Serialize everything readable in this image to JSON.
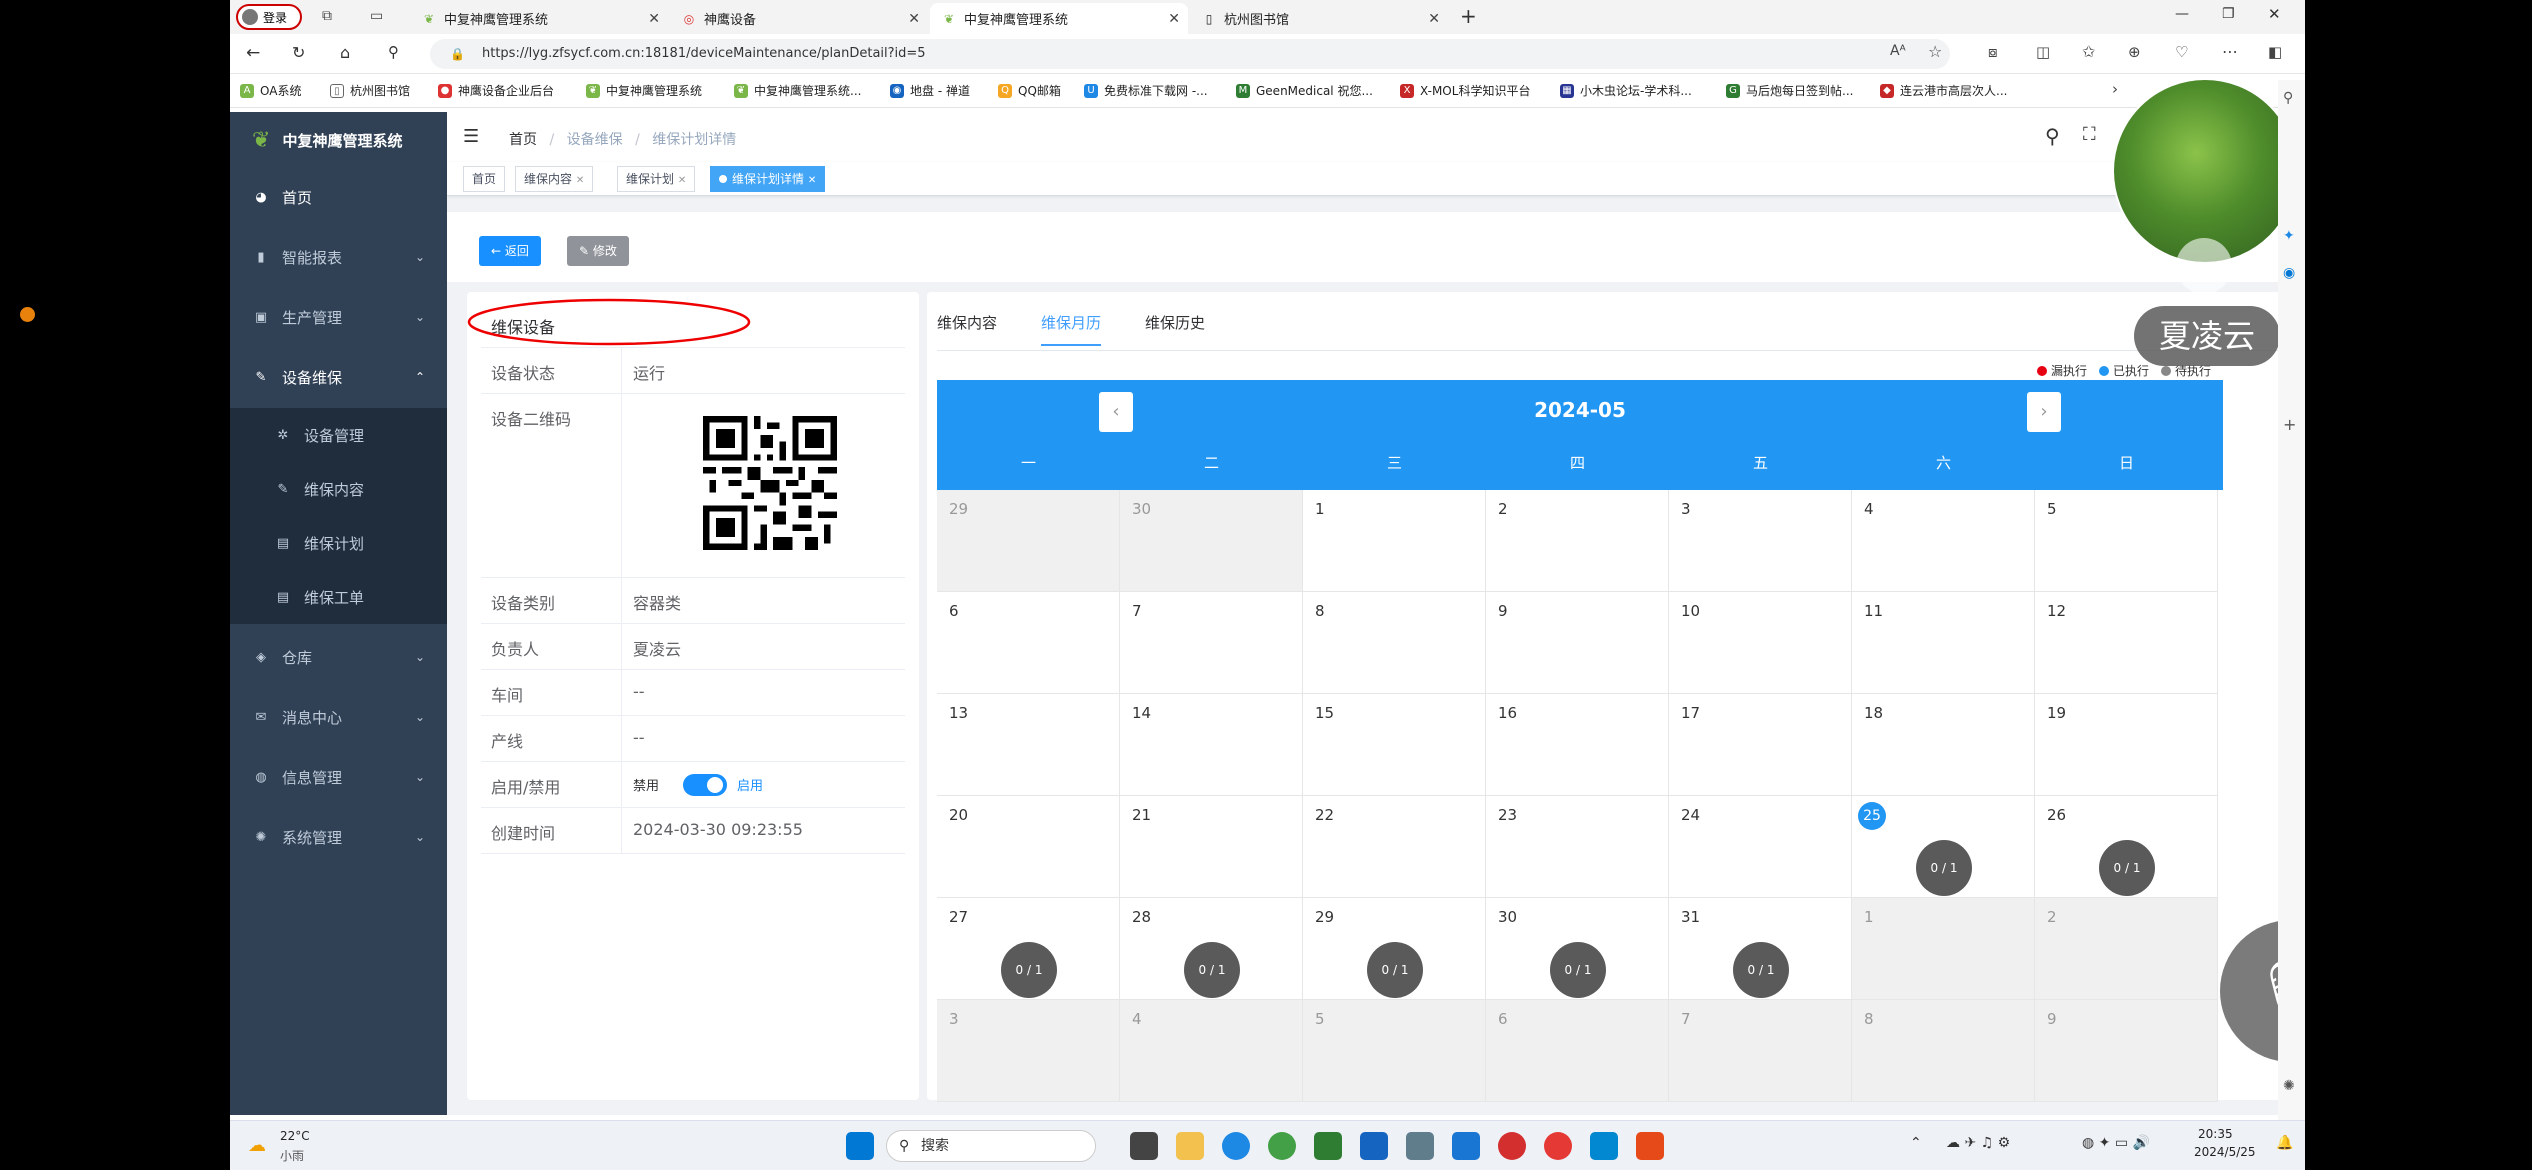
{
  "browser": {
    "login": "登录",
    "tabs": [
      {
        "label": "中复神鹰管理系统"
      },
      {
        "label": "神鹰设备"
      },
      {
        "label": "中复神鹰管理系统"
      },
      {
        "label": "杭州图书馆"
      }
    ],
    "url": "https://lyg.zfsycf.com.cn:18181/deviceMaintenance/planDetail?id=5",
    "bookmarks": [
      "OA系统",
      "杭州图书馆",
      "神鹰设备企业后台",
      "中复神鹰管理系统",
      "中复神鹰管理系统...",
      "地盘 - 禅道",
      "QQ邮箱",
      "免费标准下载网 -...",
      "GeenMedical 祝您...",
      "X-MOL科学知识平台",
      "小木虫论坛-学术科...",
      "马后炮每日签到帖...",
      "连云港市高层次人..."
    ]
  },
  "sidebar": {
    "title": "中复神鹰管理系统",
    "items": [
      {
        "label": "首页",
        "icon": "dashboard-icon"
      },
      {
        "label": "智能报表",
        "icon": "chart-icon"
      },
      {
        "label": "生产管理",
        "icon": "monitor-icon"
      },
      {
        "label": "设备维保",
        "icon": "edit-icon"
      }
    ],
    "subitems": [
      {
        "label": "设备管理"
      },
      {
        "label": "维保内容"
      },
      {
        "label": "维保计划"
      },
      {
        "label": "维保工单"
      }
    ],
    "items2": [
      {
        "label": "仓库"
      },
      {
        "label": "消息中心"
      },
      {
        "label": "信息管理"
      },
      {
        "label": "系统管理"
      }
    ]
  },
  "breadcrumb": [
    "首页",
    "设备维保",
    "维保计划详情"
  ],
  "tags": [
    "首页",
    "维保内容",
    "维保计划",
    "维保计划详情"
  ],
  "buttons": {
    "back": "返回",
    "edit": "修改"
  },
  "detail": {
    "title": "维保设备",
    "status_label": "设备状态",
    "status": "运行",
    "qr_label": "设备二维码",
    "category_label": "设备类别",
    "category": "容器类",
    "owner_label": "负责人",
    "owner": "夏凌云",
    "workshop_label": "车间",
    "workshop": "--",
    "line_label": "产线",
    "line": "--",
    "enable_label": "启用/禁用",
    "disable_text": "禁用",
    "enable_text": "启用",
    "created_label": "创建时间",
    "created": "2024-03-30 09:23:55"
  },
  "calendar_tabs": [
    "维保内容",
    "维保月历",
    "维保历史"
  ],
  "legend": [
    {
      "label": "漏执行",
      "color": "#e60012"
    },
    {
      "label": "已执行",
      "color": "#2196f3"
    },
    {
      "label": "待执行",
      "color": "#888888"
    }
  ],
  "calendar": {
    "month": "2024-05",
    "weekdays": [
      "一",
      "二",
      "三",
      "四",
      "五",
      "六",
      "日"
    ],
    "weeks": [
      [
        {
          "d": "29",
          "o": 1
        },
        {
          "d": "30",
          "o": 1
        },
        {
          "d": "1"
        },
        {
          "d": "2"
        },
        {
          "d": "3"
        },
        {
          "d": "4"
        },
        {
          "d": "5"
        }
      ],
      [
        {
          "d": "6"
        },
        {
          "d": "7"
        },
        {
          "d": "8"
        },
        {
          "d": "9"
        },
        {
          "d": "10"
        },
        {
          "d": "11"
        },
        {
          "d": "12"
        }
      ],
      [
        {
          "d": "13"
        },
        {
          "d": "14"
        },
        {
          "d": "15"
        },
        {
          "d": "16"
        },
        {
          "d": "17"
        },
        {
          "d": "18"
        },
        {
          "d": "19"
        }
      ],
      [
        {
          "d": "20"
        },
        {
          "d": "21"
        },
        {
          "d": "22"
        },
        {
          "d": "23"
        },
        {
          "d": "24"
        },
        {
          "d": "25",
          "t": 1,
          "b": "0 / 1"
        },
        {
          "d": "26",
          "b": "0 / 1"
        }
      ],
      [
        {
          "d": "27",
          "b": "0 / 1"
        },
        {
          "d": "28",
          "b": "0 / 1"
        },
        {
          "d": "29",
          "b": "0 / 1"
        },
        {
          "d": "30",
          "b": "0 / 1"
        },
        {
          "d": "31",
          "b": "0 / 1"
        },
        {
          "d": "1",
          "o": 1
        },
        {
          "d": "2",
          "o": 1
        }
      ],
      [
        {
          "d": "3",
          "o": 1
        },
        {
          "d": "4",
          "o": 1
        },
        {
          "d": "5",
          "o": 1
        },
        {
          "d": "6",
          "o": 1
        },
        {
          "d": "7",
          "o": 1
        },
        {
          "d": "8",
          "o": 1
        },
        {
          "d": "9",
          "o": 1
        }
      ]
    ]
  },
  "overlay": {
    "name": "夏凌云"
  },
  "taskbar": {
    "temp": "22°C",
    "weather": "小雨",
    "search": "搜索",
    "time": "20:35",
    "date": "2024/5/25"
  }
}
